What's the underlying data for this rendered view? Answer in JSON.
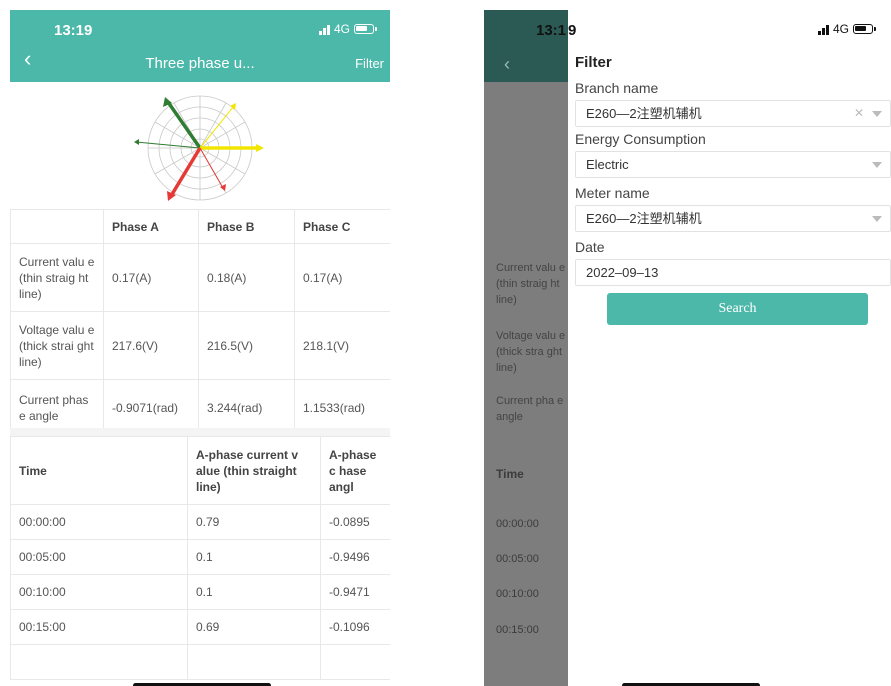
{
  "left_phone": {
    "status": {
      "time": "13:19",
      "network": "4G"
    },
    "nav": {
      "title": "Three phase u...",
      "filter_label": "Filter",
      "back_icon": "chevron-left-icon"
    },
    "summary": {
      "headers": [
        "",
        "Phase A",
        "Phase B",
        "Phase C"
      ],
      "rows": [
        {
          "label": "Current valu e (thin straig ht line)",
          "a": "0.17(A)",
          "b": "0.18(A)",
          "c": "0.17(A)"
        },
        {
          "label": "Voltage valu e (thick strai ght line)",
          "a": "217.6(V)",
          "b": "216.5(V)",
          "c": "218.1(V)"
        },
        {
          "label": "Current phas e angle",
          "a": "-0.9071(rad)",
          "b": "3.244(rad)",
          "c": "1.1533(rad)"
        }
      ]
    },
    "timeseries": {
      "headers": [
        "Time",
        "A-phase current v alue (thin straight line)",
        "A-phase c hase angl"
      ],
      "rows": [
        {
          "time": "00:00:00",
          "value": "0.79",
          "angle": "-0.0895"
        },
        {
          "time": "00:05:00",
          "value": "0.1",
          "angle": "-0.9496"
        },
        {
          "time": "00:10:00",
          "value": "0.1",
          "angle": "-0.9471"
        },
        {
          "time": "00:15:00",
          "value": "0.69",
          "angle": "-0.1096"
        }
      ]
    }
  },
  "right_phone": {
    "status": {
      "time": "13:19",
      "time_left_part": "13:1",
      "time_right_part": "9",
      "network": "4G"
    },
    "underlay": {
      "cells": [
        "Current valu e (thin straig ht line)",
        "Voltage valu e (thick stra ght line)",
        "Current pha e angle"
      ],
      "time_header": "Time",
      "times": [
        "00:00:00",
        "00:05:00",
        "00:10:00",
        "00:15:00"
      ]
    },
    "filter": {
      "title": "Filter",
      "branch_label": "Branch name",
      "branch_value": "E260—2注塑机辅机",
      "energy_label": "Energy Consumption",
      "energy_value": "Electric",
      "meter_label": "Meter name",
      "meter_value": "E260—2注塑机辅机",
      "date_label": "Date",
      "date_value": "2022–09–13",
      "search_label": "Search"
    }
  },
  "colors": {
    "accent": "#4cb8a9",
    "phase_a": "#e53935",
    "phase_b": "#2e7d32",
    "phase_c": "#f2e600"
  }
}
